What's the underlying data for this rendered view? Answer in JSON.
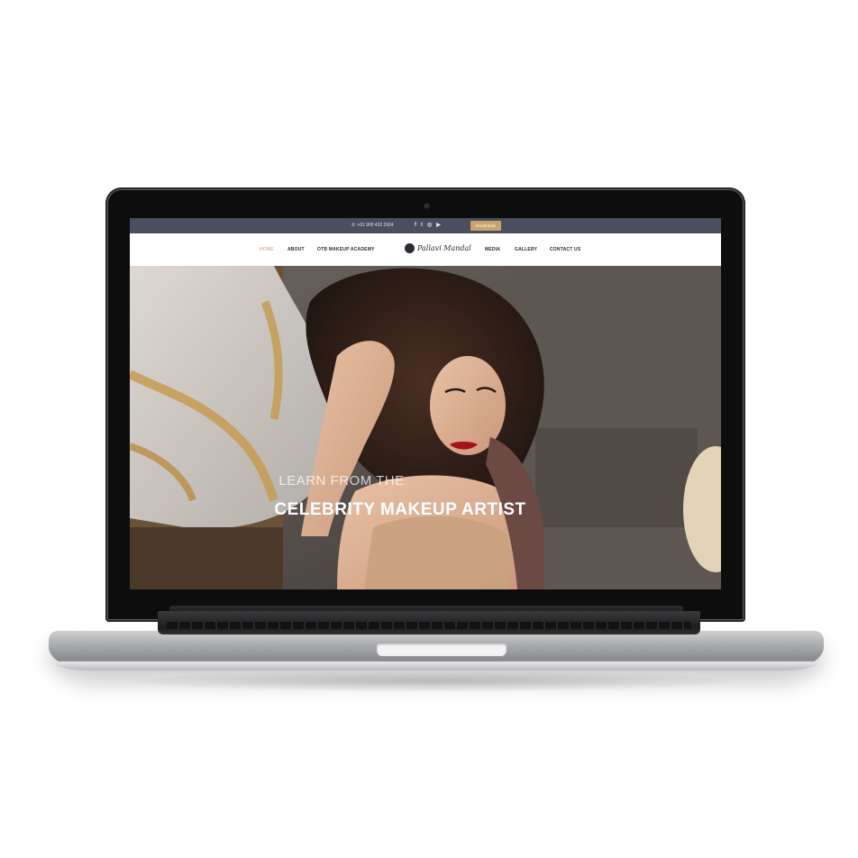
{
  "topbar": {
    "phone": "+91 900 432 2924",
    "phone_icon": "phone-icon",
    "social_icons": [
      "facebook-icon",
      "twitter-icon",
      "instagram-icon",
      "youtube-icon"
    ],
    "enroll_button": "Enroll Now"
  },
  "navbar": {
    "items": [
      {
        "label": "HOME",
        "active": true
      },
      {
        "label": "ABOUT"
      },
      {
        "label": "OTB MAKEUP ACADEMY"
      },
      {
        "label": "MEDIA"
      },
      {
        "label": "GALLERY"
      },
      {
        "label": "CONTACT US"
      }
    ],
    "logo_text": "Pallavi Mandal"
  },
  "hero": {
    "subtitle": "LEARN FROM THE",
    "title": "CELEBRITY MAKEUP ARTIST"
  },
  "colors": {
    "topbar_bg": "#4b4e5f",
    "accent_gold": "#c9a46a",
    "nav_text": "#2b2b33"
  }
}
